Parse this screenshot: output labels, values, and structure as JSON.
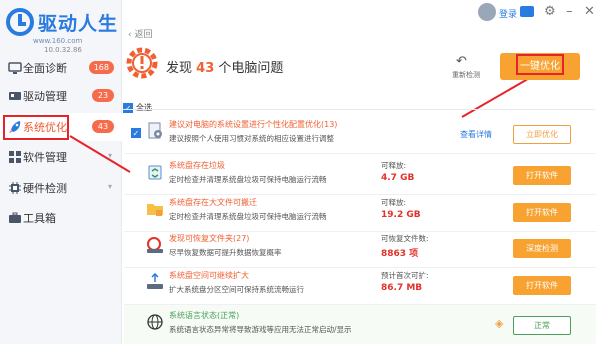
{
  "app": {
    "brand": "驱动人生",
    "url": "www.160.com",
    "version": "10.0.32.86"
  },
  "colors": {
    "brand_blue": "#2a7be0",
    "accent_orange": "#f7a231",
    "alert_red": "#e6232a",
    "ok_green": "#4aa05a"
  },
  "topbar": {
    "login_label": "登录",
    "icons": [
      "user-avatar-icon",
      "vip-cap-icon",
      "gear-icon",
      "minimize-icon",
      "close-icon"
    ]
  },
  "sidebar": {
    "items": [
      {
        "label": "全面诊断",
        "badge": "168",
        "icon": "monitor-icon"
      },
      {
        "label": "驱动管理",
        "badge": "23",
        "icon": "driver-icon"
      },
      {
        "label": "系统优化",
        "badge": "43",
        "icon": "rocket-icon",
        "active": true
      },
      {
        "label": "软件管理",
        "badge": "",
        "icon": "apps-icon"
      },
      {
        "label": "硬件检测",
        "badge": "",
        "icon": "hardware-icon"
      },
      {
        "label": "工具箱",
        "badge": "",
        "icon": "toolbox-icon"
      }
    ]
  },
  "main": {
    "back_label": "返回",
    "summary": {
      "prefix": "发现",
      "count": "43",
      "suffix": "个电脑问题"
    },
    "rescan_label": "重新检测",
    "oneclick_label": "一键优化",
    "select_all_label": "全选",
    "rows": [
      {
        "title": "建议对电脑的系统设置进行个性化配置优化(13)",
        "desc": "建议按照个人使用习惯对系统的相应设置进行调整",
        "metric_key": "",
        "metric_value": "",
        "link": "查看详情",
        "button": "立即优化",
        "icon": "settings-doc-icon"
      },
      {
        "title": "系统盘存在垃圾",
        "desc": "定时检查并清理系统盘垃圾可保持电脑运行流畅",
        "metric_key": "可释放:",
        "metric_value": "4.7 GB",
        "link": "",
        "button": "打开软件",
        "icon": "recycle-bin-icon"
      },
      {
        "title": "系统盘存在大文件可搬迁",
        "desc": "定时检查并清理系统盘垃圾可保持电脑运行流畅",
        "metric_key": "可释放:",
        "metric_value": "19.2 GB",
        "link": "",
        "button": "打开软件",
        "icon": "folder-icon"
      },
      {
        "title": "发现可恢复文件夹(27)",
        "desc": "尽早恢复数据可提升数据恢复概率",
        "metric_key": "可恢复文件数:",
        "metric_value": "8863 项",
        "link": "",
        "button": "深度检测",
        "icon": "recovery-disk-icon"
      },
      {
        "title": "系统盘空间可继续扩大",
        "desc": "扩大系统盘分区空间可保持系统流畅运行",
        "metric_key": "预计首次可扩:",
        "metric_value": "86.7 MB",
        "link": "",
        "button": "打开软件",
        "icon": "expand-drive-icon"
      },
      {
        "title": "系统语言状态(正常)",
        "desc": "系统语言状态异常将导致游戏等应用无法正常启动/显示",
        "metric_key": "",
        "metric_value": "",
        "link": "",
        "button": "正常",
        "icon": "globe-icon"
      }
    ]
  }
}
